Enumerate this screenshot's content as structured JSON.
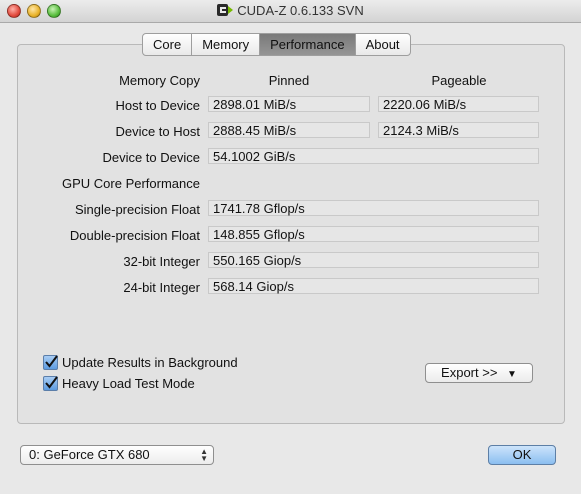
{
  "window": {
    "title": "CUDA-Z 0.6.133 SVN",
    "icon": "cuda-z-app-icon"
  },
  "tabs": [
    {
      "label": "Core",
      "active": false
    },
    {
      "label": "Memory",
      "active": false
    },
    {
      "label": "Performance",
      "active": true
    },
    {
      "label": "About",
      "active": false
    }
  ],
  "memory_copy": {
    "section_label": "Memory Copy",
    "col_pinned": "Pinned",
    "col_pageable": "Pageable",
    "rows": [
      {
        "label": "Host to Device",
        "pinned": "2898.01 MiB/s",
        "pageable": "2220.06 MiB/s"
      },
      {
        "label": "Device to Host",
        "pinned": "2888.45 MiB/s",
        "pageable": "2124.3 MiB/s"
      },
      {
        "label": "Device to Device",
        "value": "54.1002 GiB/s"
      }
    ]
  },
  "gpu_core": {
    "section_label": "GPU Core Performance",
    "rows": [
      {
        "label": "Single-precision Float",
        "value": "1741.78 Gflop/s"
      },
      {
        "label": "Double-precision Float",
        "value": "148.855 Gflop/s"
      },
      {
        "label": "32-bit Integer",
        "value": "550.165 Giop/s"
      },
      {
        "label": "24-bit Integer",
        "value": "568.14 Giop/s"
      }
    ]
  },
  "options": {
    "update_background": {
      "label": "Update Results in Background",
      "checked": true
    },
    "heavy_load": {
      "label": "Heavy Load Test Mode",
      "checked": true
    }
  },
  "export_button": {
    "label": "Export >>",
    "icon": "triangle-down-icon"
  },
  "device_select": {
    "value": "0: GeForce GTX 680"
  },
  "ok_button": {
    "label": "OK"
  }
}
